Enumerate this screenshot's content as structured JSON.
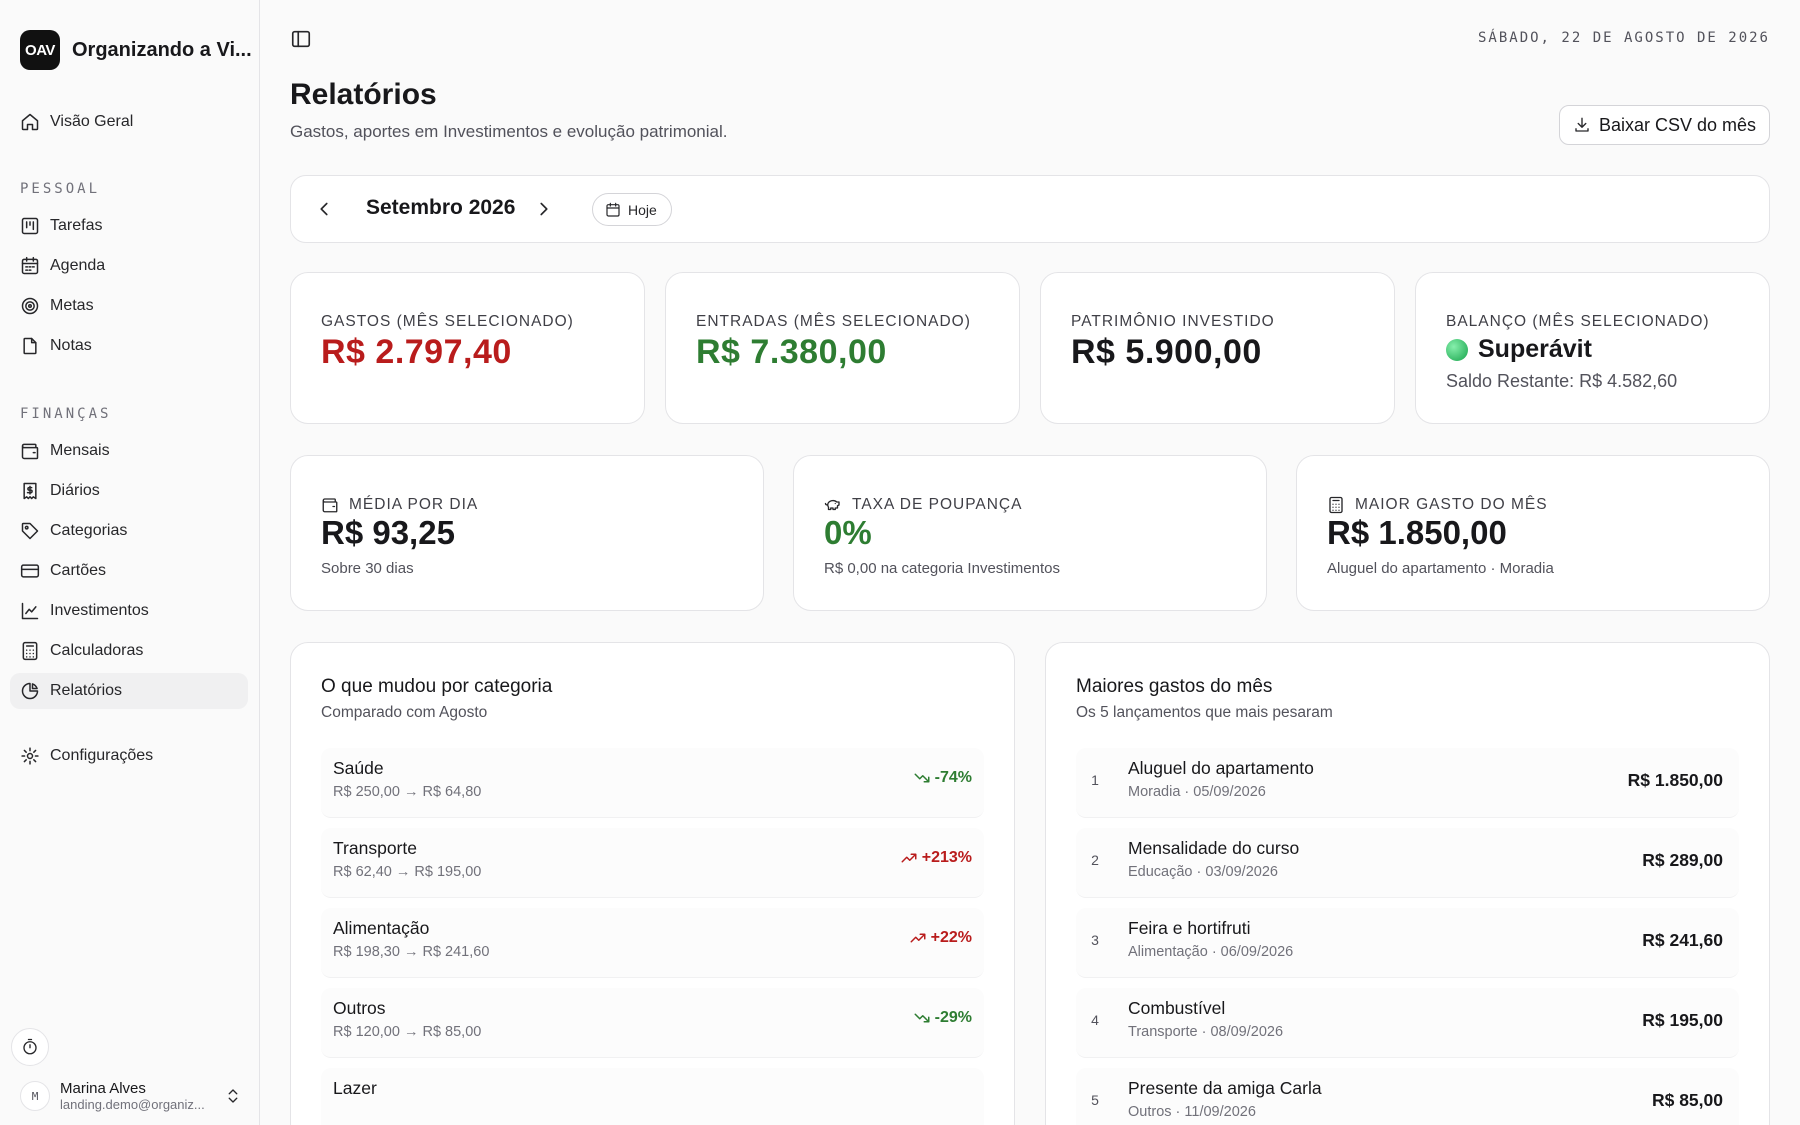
{
  "app": {
    "logo_text": "OAV",
    "name": "Organizando a Vi..."
  },
  "sidebar": {
    "overview": "Visão Geral",
    "personal_label": "PESSOAL",
    "personal": [
      {
        "label": "Tarefas",
        "icon": "kanban-icon"
      },
      {
        "label": "Agenda",
        "icon": "calendar-icon"
      },
      {
        "label": "Metas",
        "icon": "target-icon"
      },
      {
        "label": "Notas",
        "icon": "note-icon"
      }
    ],
    "finance_label": "FINANÇAS",
    "finance": [
      {
        "label": "Mensais",
        "icon": "wallet-icon"
      },
      {
        "label": "Diários",
        "icon": "receipt-icon"
      },
      {
        "label": "Categorias",
        "icon": "tag-icon"
      },
      {
        "label": "Cartões",
        "icon": "credit-card-icon"
      },
      {
        "label": "Investimentos",
        "icon": "line-chart-icon"
      },
      {
        "label": "Calculadoras",
        "icon": "calculator-icon"
      },
      {
        "label": "Relatórios",
        "icon": "pie-chart-icon",
        "active": true
      }
    ],
    "settings": "Configurações",
    "user": {
      "initial": "M",
      "name": "Marina Alves",
      "email": "landing.demo@organiz..."
    }
  },
  "header": {
    "date": "SÁBADO, 22 DE AGOSTO DE 2026",
    "title": "Relatórios",
    "subtitle": "Gastos, aportes em Investimentos e evolução patrimonial.",
    "csv_button": "Baixar CSV do mês"
  },
  "month_nav": {
    "label": "Setembro 2026",
    "today": "Hoje"
  },
  "stats": {
    "expenses": {
      "label": "GASTOS (MÊS SELECIONADO)",
      "value": "R$ 2.797,40"
    },
    "income": {
      "label": "ENTRADAS (MÊS SELECIONADO)",
      "value": "R$ 7.380,00"
    },
    "invested": {
      "label": "PATRIMÔNIO INVESTIDO",
      "value": "R$ 5.900,00"
    },
    "balance": {
      "label": "BALANÇO (MÊS SELECIONADO)",
      "status": "Superávit",
      "remaining": "Saldo Restante: R$ 4.582,60"
    }
  },
  "metrics": {
    "daily_avg": {
      "label": "MÉDIA POR DIA",
      "value": "R$ 93,25",
      "sub": "Sobre 30 dias"
    },
    "savings_rate": {
      "label": "TAXA DE POUPANÇA",
      "value": "0%",
      "sub": "R$ 0,00 na categoria Investimentos"
    },
    "largest": {
      "label": "MAIOR GASTO DO MÊS",
      "value": "R$ 1.850,00",
      "sub": "Aluguel do apartamento · Moradia"
    }
  },
  "changes": {
    "title": "O que mudou por categoria",
    "subtitle": "Comparado com Agosto",
    "rows": [
      {
        "name": "Saúde",
        "detail": "R$ 250,00 → R$ 64,80",
        "change": "-74%",
        "direction": "down",
        "color": "#2e7d32"
      },
      {
        "name": "Transporte",
        "detail": "R$ 62,40 → R$ 195,00",
        "change": "+213%",
        "direction": "up",
        "color": "#b91c1c"
      },
      {
        "name": "Alimentação",
        "detail": "R$ 198,30 → R$ 241,60",
        "change": "+22%",
        "direction": "up",
        "color": "#b91c1c"
      },
      {
        "name": "Outros",
        "detail": "R$ 120,00 → R$ 85,00",
        "change": "-29%",
        "direction": "down",
        "color": "#2e7d32"
      },
      {
        "name": "Lazer",
        "detail": "",
        "change": "",
        "direction": "",
        "color": "#2e7d32"
      }
    ]
  },
  "top_expenses": {
    "title": "Maiores gastos do mês",
    "subtitle": "Os 5 lançamentos que mais pesaram",
    "rows": [
      {
        "rank": "1",
        "name": "Aluguel do apartamento",
        "detail": "Moradia · 05/09/2026",
        "amount": "R$ 1.850,00"
      },
      {
        "rank": "2",
        "name": "Mensalidade do curso",
        "detail": "Educação · 03/09/2026",
        "amount": "R$ 289,00"
      },
      {
        "rank": "3",
        "name": "Feira e hortifruti",
        "detail": "Alimentação · 06/09/2026",
        "amount": "R$ 241,60"
      },
      {
        "rank": "4",
        "name": "Combustível",
        "detail": "Transporte · 08/09/2026",
        "amount": "R$ 195,00"
      },
      {
        "rank": "5",
        "name": "Presente da amiga Carla",
        "detail": "Outros · 11/09/2026",
        "amount": "R$ 85,00"
      }
    ]
  }
}
